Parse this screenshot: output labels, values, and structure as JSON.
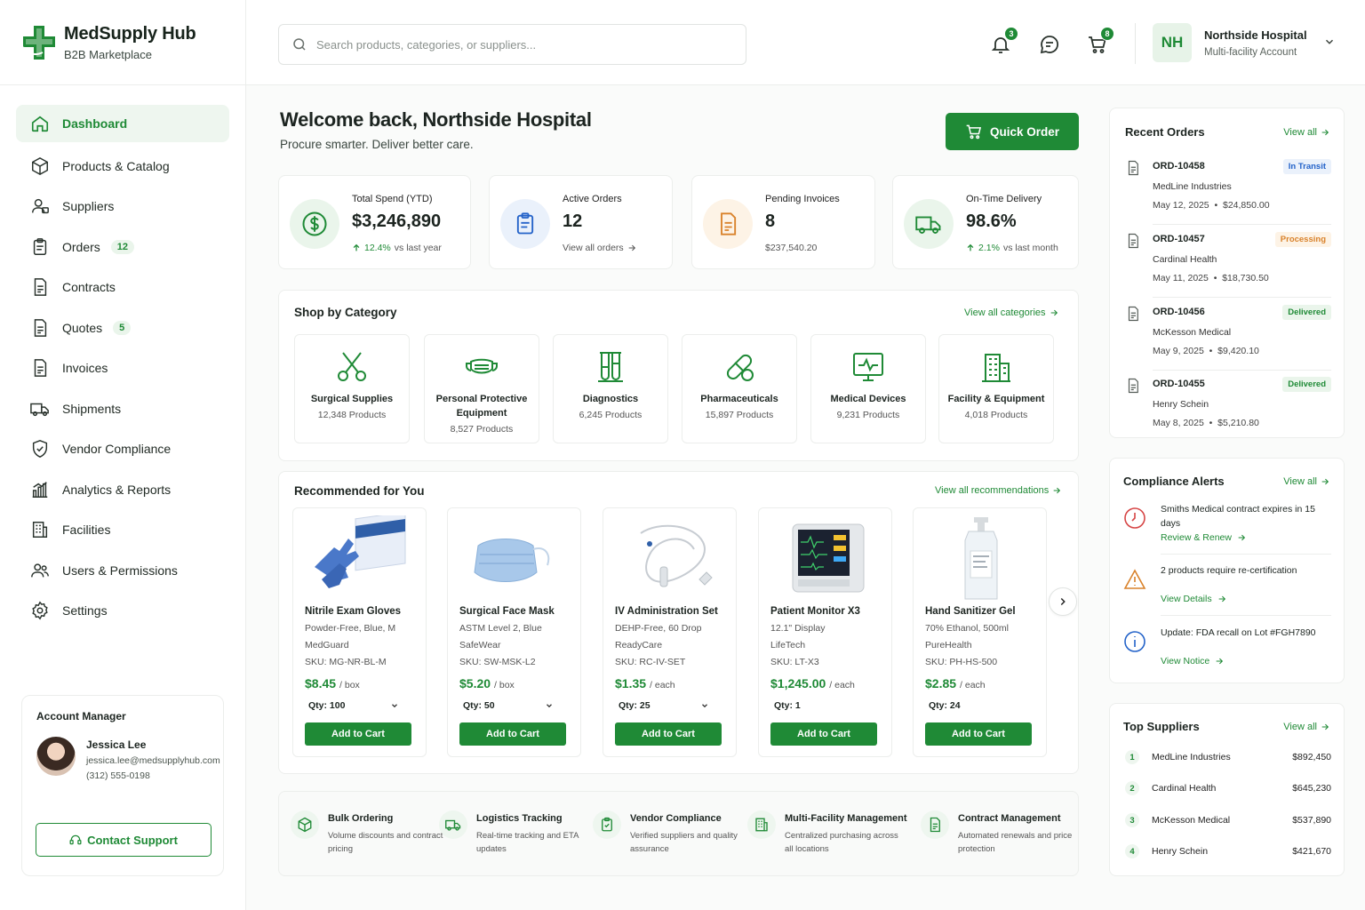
{
  "brand": {
    "title": "MedSupply Hub",
    "subtitle": "B2B Marketplace"
  },
  "sidebar": {
    "items": [
      {
        "label": "Dashboard",
        "icon": "home-icon",
        "active": true
      },
      {
        "label": "Products & Catalog",
        "icon": "box-icon"
      },
      {
        "label": "Suppliers",
        "icon": "supplier-icon"
      },
      {
        "label": "Orders",
        "icon": "clipboard-icon",
        "badge": "12"
      },
      {
        "label": "Contracts",
        "icon": "document-icon"
      },
      {
        "label": "Quotes",
        "icon": "document-icon",
        "badge": "5"
      },
      {
        "label": "Invoices",
        "icon": "document-icon"
      },
      {
        "label": "Shipments",
        "icon": "truck-icon"
      },
      {
        "label": "Vendor Compliance",
        "icon": "shield-icon"
      },
      {
        "label": "Analytics & Reports",
        "icon": "chart-icon"
      },
      {
        "label": "Facilities",
        "icon": "building-icon"
      },
      {
        "label": "Users & Permissions",
        "icon": "users-icon"
      },
      {
        "label": "Settings",
        "icon": "gear-icon"
      }
    ]
  },
  "account_manager": {
    "heading": "Account Manager",
    "name": "Jessica Lee",
    "email": "jessica.lee@medsupplyhub.com",
    "phone": "(312) 555-0198",
    "support_label": "Contact Support"
  },
  "header": {
    "search_placeholder": "Search products, categories, or suppliers...",
    "notifications_count": "3",
    "cart_count": "8",
    "org_initials": "NH",
    "org_name": "Northside Hospital",
    "org_sub": "Multi-facility Account"
  },
  "welcome": {
    "title": "Welcome back, Northside Hospital",
    "subtitle": "Procure smarter. Deliver better care.",
    "quick_order_label": "Quick Order"
  },
  "stats": [
    {
      "label": "Total Spend (YTD)",
      "value": "$3,246,890",
      "trend": "12.4%",
      "trend_note": "vs last year",
      "icon": "dollar-icon"
    },
    {
      "label": "Active Orders",
      "value": "12",
      "footer": "View all orders",
      "icon": "clipboard-icon"
    },
    {
      "label": "Pending Invoices",
      "value": "8",
      "footer": "$237,540.20",
      "icon": "invoice-icon"
    },
    {
      "label": "On-Time Delivery",
      "value": "98.6%",
      "trend": "2.1%",
      "trend_note": "vs last month",
      "icon": "truck-icon"
    }
  ],
  "categories": {
    "title": "Shop by Category",
    "view_all": "View all categories",
    "items": [
      {
        "name": "Surgical Supplies",
        "count": "12,348 Products",
        "icon": "scissors-icon"
      },
      {
        "name": "Personal Protective Equipment",
        "count": "8,527 Products",
        "icon": "mask-icon"
      },
      {
        "name": "Diagnostics",
        "count": "6,245 Products",
        "icon": "test-tubes-icon"
      },
      {
        "name": "Pharmaceuticals",
        "count": "15,897 Products",
        "icon": "pill-icon"
      },
      {
        "name": "Medical Devices",
        "count": "9,231 Products",
        "icon": "monitor-icon"
      },
      {
        "name": "Facility & Equipment",
        "count": "4,018 Products",
        "icon": "building-icon"
      }
    ]
  },
  "recommended": {
    "title": "Recommended for You",
    "view_all": "View all recommendations",
    "products": [
      {
        "name": "Nitrile Exam Gloves",
        "spec": "Powder-Free, Blue, M",
        "vendor": "MedGuard",
        "sku": "SKU: MG-NR-BL-M",
        "price": "$8.45",
        "unit": "/ box",
        "qty": "Qty: 100",
        "has_select": true,
        "cta": "Add to Cart"
      },
      {
        "name": "Surgical Face Mask",
        "spec": "ASTM Level 2, Blue",
        "vendor": "SafeWear",
        "sku": "SKU: SW-MSK-L2",
        "price": "$5.20",
        "unit": "/ box",
        "qty": "Qty: 50",
        "has_select": true,
        "cta": "Add to Cart"
      },
      {
        "name": "IV Administration Set",
        "spec": "DEHP-Free, 60 Drop",
        "vendor": "ReadyCare",
        "sku": "SKU: RC-IV-SET",
        "price": "$1.35",
        "unit": "/ each",
        "qty": "Qty: 25",
        "has_select": true,
        "cta": "Add to Cart"
      },
      {
        "name": "Patient Monitor X3",
        "spec": "12.1\" Display",
        "vendor": "LifeTech",
        "sku": "SKU: LT-X3",
        "price": "$1,245.00",
        "unit": "/ each",
        "qty": "Qty: 1",
        "has_select": false,
        "cta": "Add to Cart"
      },
      {
        "name": "Hand Sanitizer Gel",
        "spec": "70% Ethanol, 500ml",
        "vendor": "PureHealth",
        "sku": "SKU: PH-HS-500",
        "price": "$2.85",
        "unit": "/ each",
        "qty": "Qty: 24",
        "has_select": false,
        "cta": "Add to Cart"
      }
    ]
  },
  "features": [
    {
      "title": "Bulk Ordering",
      "desc": "Volume discounts and contract pricing",
      "icon": "box-icon"
    },
    {
      "title": "Logistics Tracking",
      "desc": "Real-time tracking and ETA updates",
      "icon": "truck-icon"
    },
    {
      "title": "Vendor Compliance",
      "desc": "Verified suppliers and quality assurance",
      "icon": "clipboard-check-icon"
    },
    {
      "title": "Multi-Facility Management",
      "desc": "Centralized purchasing across all locations",
      "icon": "building-icon"
    },
    {
      "title": "Contract Management",
      "desc": "Automated renewals and price protection",
      "icon": "document-icon"
    }
  ],
  "recent_orders": {
    "title": "Recent Orders",
    "view_all": "View all",
    "items": [
      {
        "id": "ORD-10458",
        "status": "In Transit",
        "vendor": "MedLine Industries",
        "date": "May 12, 2025",
        "amount": "$24,850.00"
      },
      {
        "id": "ORD-10457",
        "status": "Processing",
        "vendor": "Cardinal Health",
        "date": "May 11, 2025",
        "amount": "$18,730.50"
      },
      {
        "id": "ORD-10456",
        "status": "Delivered",
        "vendor": "McKesson Medical",
        "date": "May 9, 2025",
        "amount": "$9,420.10"
      },
      {
        "id": "ORD-10455",
        "status": "Delivered",
        "vendor": "Henry Schein",
        "date": "May 8, 2025",
        "amount": "$5,210.80"
      }
    ]
  },
  "compliance": {
    "title": "Compliance Alerts",
    "view_all": "View all",
    "items": [
      {
        "text": "Smiths Medical contract expires in 15 days",
        "link": "Review & Renew",
        "type": "clock-alert-icon"
      },
      {
        "text": "2 products require re-certification",
        "link": "View Details",
        "type": "warning-icon"
      },
      {
        "text": "Update: FDA recall on Lot #FGH7890",
        "link": "View Notice",
        "type": "info-icon"
      }
    ]
  },
  "top_suppliers": {
    "title": "Top Suppliers",
    "view_all": "View all",
    "items": [
      {
        "rank": "1",
        "name": "MedLine Industries",
        "amount": "$892,450"
      },
      {
        "rank": "2",
        "name": "Cardinal Health",
        "amount": "$645,230"
      },
      {
        "rank": "3",
        "name": "McKesson Medical",
        "amount": "$537,890"
      },
      {
        "rank": "4",
        "name": "Henry Schein",
        "amount": "$421,670"
      }
    ]
  },
  "colors": {
    "accent": "#1f8a36",
    "accent_light": "#eef6ef",
    "in_transit": "#2463c9",
    "processing": "#d9822b",
    "delivered": "#1f8a36"
  }
}
